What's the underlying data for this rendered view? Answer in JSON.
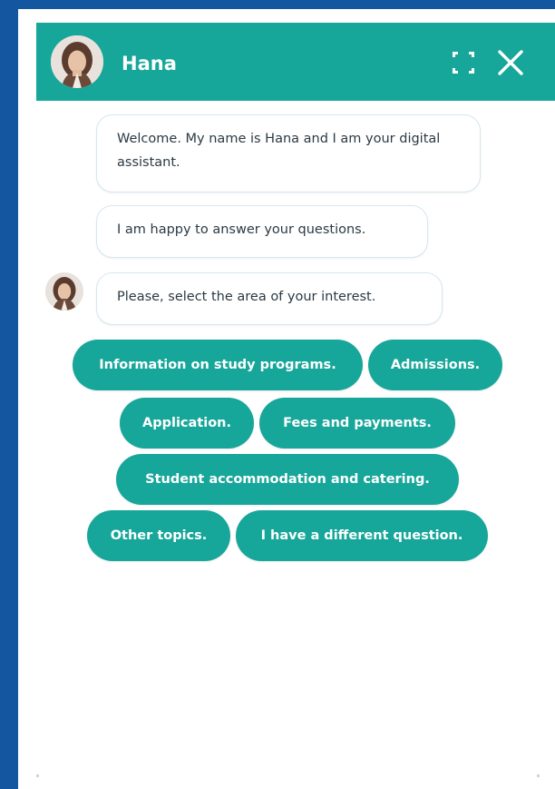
{
  "header": {
    "agent_name": "Hana",
    "expand_icon": "expand-icon",
    "close_icon": "close-icon"
  },
  "messages": [
    {
      "text": "Welcome. My name is Hana and I am your digital assistant."
    },
    {
      "text": "I am happy to answer your questions."
    },
    {
      "text": "Please, select the area of your interest."
    }
  ],
  "quick_replies": [
    {
      "label": "Information on study programs."
    },
    {
      "label": "Admissions."
    },
    {
      "label": "Application."
    },
    {
      "label": "Fees and payments."
    },
    {
      "label": "Student accommodation and catering."
    },
    {
      "label": "Other topics."
    },
    {
      "label": "I have a different question."
    }
  ],
  "colors": {
    "accent": "#17a69a",
    "page_background": "#1457a0",
    "bubble_border": "#d6e7ef"
  }
}
